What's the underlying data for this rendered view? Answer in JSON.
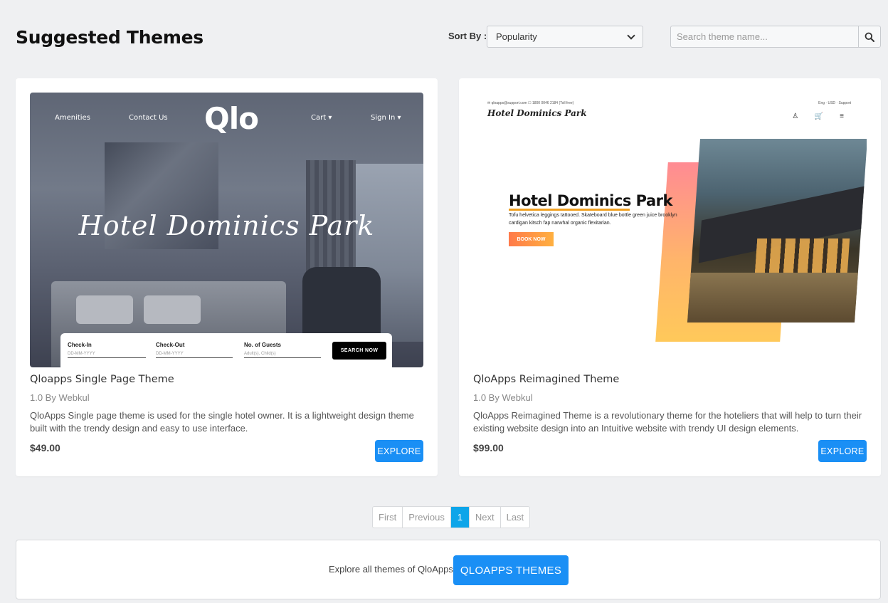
{
  "header": {
    "title": "Suggested Themes",
    "sort_label": "Sort By :",
    "sort_value": "Popularity",
    "search_placeholder": "Search theme name..."
  },
  "cards": [
    {
      "title": "Qloapps Single Page Theme",
      "version": "1.0 By Webkul",
      "description": "QloApps Single page theme is used for the single hotel owner. It is a lightweight design theme built with the trendy design and easy to use interface.",
      "price": "$49.00",
      "button": "EXPLORE",
      "preview": {
        "nav": [
          "Amenities",
          "Contact Us",
          "Cart ▾",
          "Sign In ▾"
        ],
        "logo": "Qlo",
        "hero": "Hotel Dominics Park",
        "fields": [
          {
            "label": "Check-In",
            "placeholder": "DD-MM-YYYY"
          },
          {
            "label": "Check-Out",
            "placeholder": "DD-MM-YYYY"
          },
          {
            "label": "No. of Guests",
            "placeholder": "Adult(s), Child(s)"
          }
        ],
        "button": "SEARCH NOW"
      }
    },
    {
      "title": "QloApps Reimagined Theme",
      "version": "1.0 By Webkul",
      "description": "QloApps Reimagined Theme is a revolutionary theme for the hoteliers that will help to turn their existing website design into an Intuitive website with trendy UI design elements.",
      "price": "$99.00",
      "button": "EXPLORE",
      "preview": {
        "topbar_left": "✉ qloapps@support.com   ☐ 1800 0046 2184 (Toll free)",
        "topbar_right": "Eng ·   USD ·   Support",
        "logo": "Hotel Dominics Park",
        "icons": "♙ 🛒 ≡",
        "hero_title": "Hotel Dominics Park",
        "hero_sub": "Tofu helvetica leggings tattooed. Skateboard blue bottle green juice brooklyn cardigan kitsch fap narwhal organic flexitarian.",
        "hero_button": "BOOK NOW"
      }
    }
  ],
  "pagination": [
    "First",
    "Previous",
    "1",
    "Next",
    "Last"
  ],
  "footer": {
    "text": "Explore all themes of QloApps",
    "button": "QLOAPPS THEMES"
  },
  "colors": {
    "accent": "#1a8ff5",
    "page_active": "#0ea5e9",
    "background": "#eff0f2"
  }
}
